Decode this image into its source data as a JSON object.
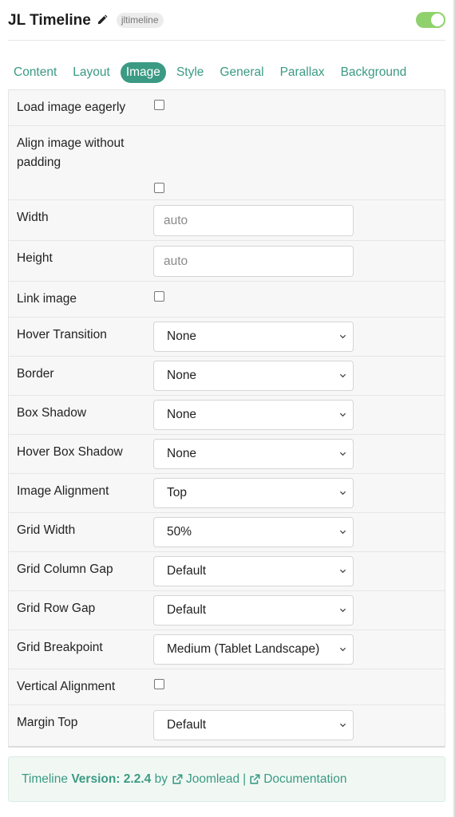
{
  "header": {
    "title": "JL Timeline",
    "slug": "jltimeline",
    "enabled": true
  },
  "tabs": [
    {
      "label": "Content",
      "active": false
    },
    {
      "label": "Layout",
      "active": false
    },
    {
      "label": "Image",
      "active": true
    },
    {
      "label": "Style",
      "active": false
    },
    {
      "label": "General",
      "active": false
    },
    {
      "label": "Parallax",
      "active": false
    },
    {
      "label": "Background",
      "active": false
    }
  ],
  "fields": {
    "load_eagerly": {
      "label": "Load image eagerly",
      "checked": false
    },
    "align_no_padding": {
      "label": "Align image without padding",
      "checked": false
    },
    "width": {
      "label": "Width",
      "placeholder": "auto"
    },
    "height": {
      "label": "Height",
      "placeholder": "auto"
    },
    "link_image": {
      "label": "Link image",
      "checked": false
    },
    "hover_transition": {
      "label": "Hover Transition",
      "value": "None"
    },
    "border": {
      "label": "Border",
      "value": "None"
    },
    "box_shadow": {
      "label": "Box Shadow",
      "value": "None"
    },
    "hover_box_shadow": {
      "label": "Hover Box Shadow",
      "value": "None"
    },
    "image_alignment": {
      "label": "Image Alignment",
      "value": "Top"
    },
    "grid_width": {
      "label": "Grid Width",
      "value": "50%"
    },
    "grid_column_gap": {
      "label": "Grid Column Gap",
      "value": "Default"
    },
    "grid_row_gap": {
      "label": "Grid Row Gap",
      "value": "Default"
    },
    "grid_breakpoint": {
      "label": "Grid Breakpoint",
      "value": "Medium (Tablet Landscape)"
    },
    "vertical_alignment": {
      "label": "Vertical Alignment",
      "checked": false
    },
    "margin_top": {
      "label": "Margin Top",
      "value": "Default"
    }
  },
  "footer": {
    "prefix": "Timeline",
    "version_label": "Version: 2.2.4",
    "by": "by",
    "link1": "Joomlead",
    "separator": "|",
    "link2": "Documentation"
  },
  "icons": {
    "edit": "pencil-icon",
    "dropdown": "chevron-down-icon",
    "external": "external-link-icon"
  },
  "colors": {
    "accent": "#3b9a83",
    "toggle_on": "#8fd16c",
    "footer_bg": "#f1f8f4"
  }
}
